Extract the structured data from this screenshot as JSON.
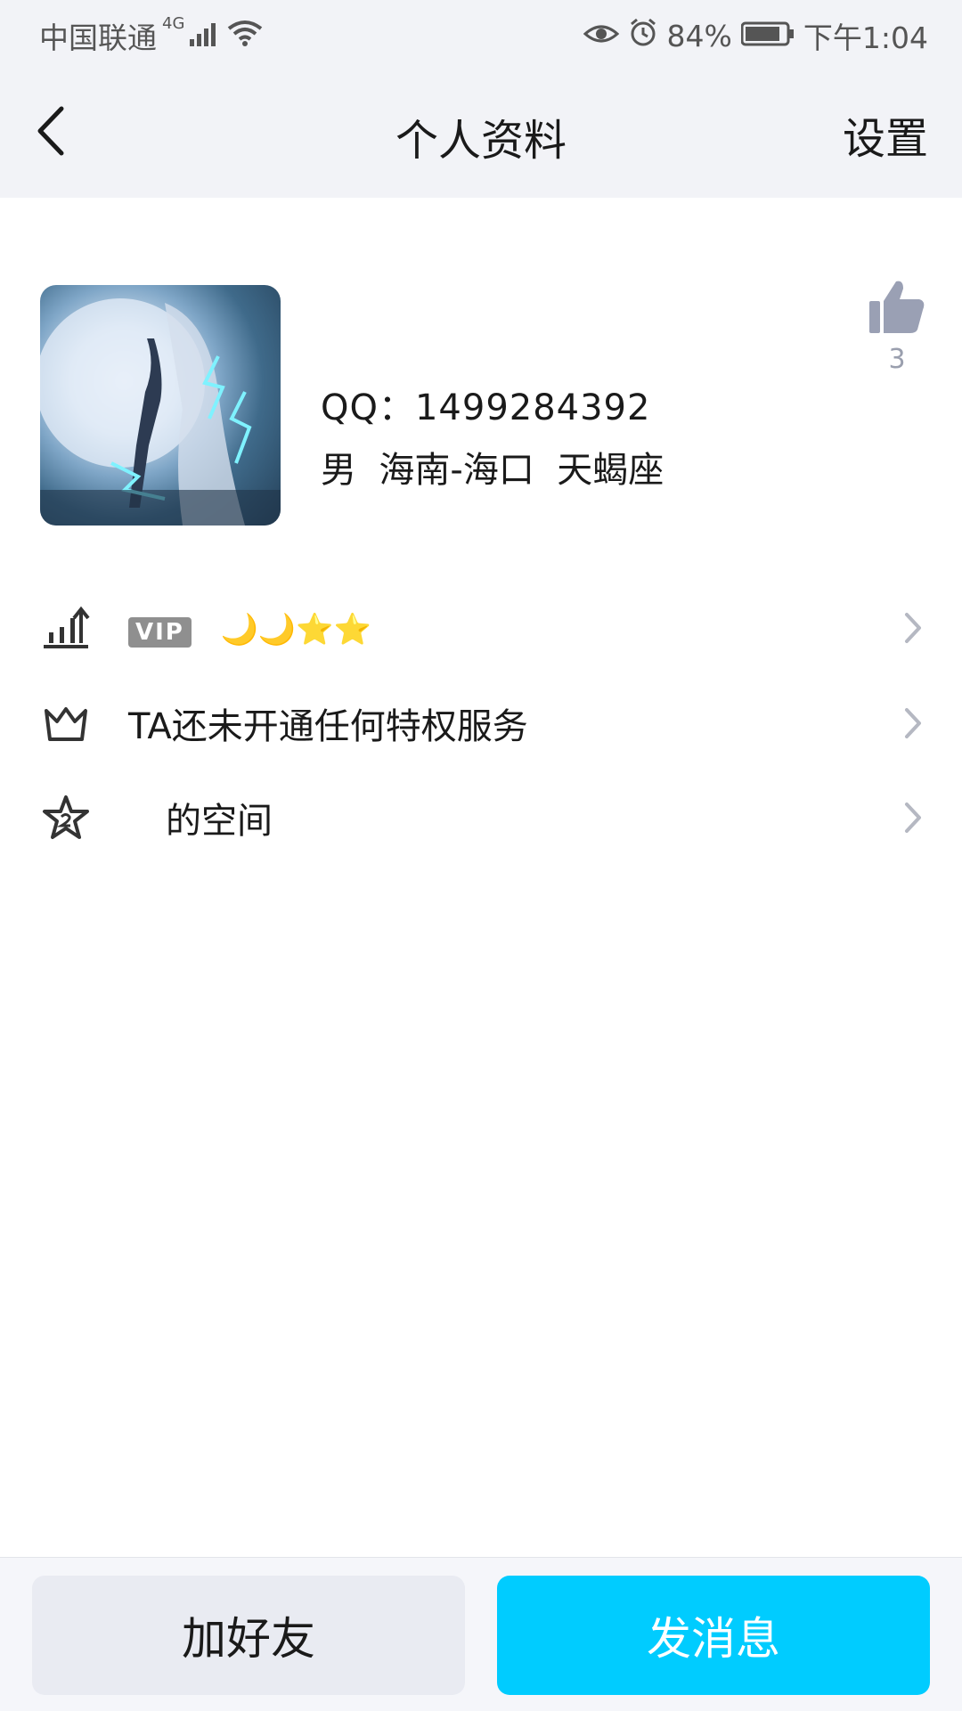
{
  "status_bar": {
    "carrier": "中国联通",
    "network": "4G",
    "battery": "84%",
    "time": "下午1:04"
  },
  "nav": {
    "title": "个人资料",
    "settings_label": "设置"
  },
  "profile": {
    "qq_line": "QQ：1499284392",
    "info_line": "男  海南-海口  天蝎座",
    "like_count": "3"
  },
  "rows": [
    {
      "badge": "VIP",
      "levels": "🌙🌙⭐⭐"
    },
    {
      "label": "TA还未开通任何特权服务"
    },
    {
      "label": "的空间"
    }
  ],
  "actions": {
    "add_friend": "加好友",
    "send_message": "发消息"
  },
  "colors": {
    "accent": "#00ccff",
    "header_bg": "#f2f3f7",
    "secondary_button": "#e9ebf2"
  }
}
